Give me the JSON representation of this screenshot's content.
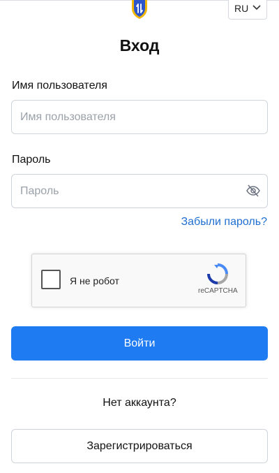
{
  "header": {
    "logo_icon": "shield-arrows-icon",
    "language": {
      "selected": "RU",
      "icon": "chevron-down-icon"
    }
  },
  "form": {
    "title": "Вход",
    "username": {
      "label": "Имя пользователя",
      "placeholder": "Имя пользователя",
      "value": ""
    },
    "password": {
      "label": "Пароль",
      "placeholder": "Пароль",
      "value": "",
      "toggle_icon": "eye-off-icon"
    },
    "forgot_link": "Забыли пароль?",
    "captcha": {
      "label": "Я не робот",
      "brand": "reCAPTCHA",
      "icon": "recaptcha-icon",
      "checked": false
    },
    "submit_label": "Войти"
  },
  "footer": {
    "no_account_text": "Нет аккаунта?",
    "register_label": "Зарегистрироваться"
  },
  "colors": {
    "primary": "#1e7bf2",
    "link": "#1f6fd1",
    "logo_blue": "#2b55c8",
    "logo_gold": "#f2b705"
  }
}
